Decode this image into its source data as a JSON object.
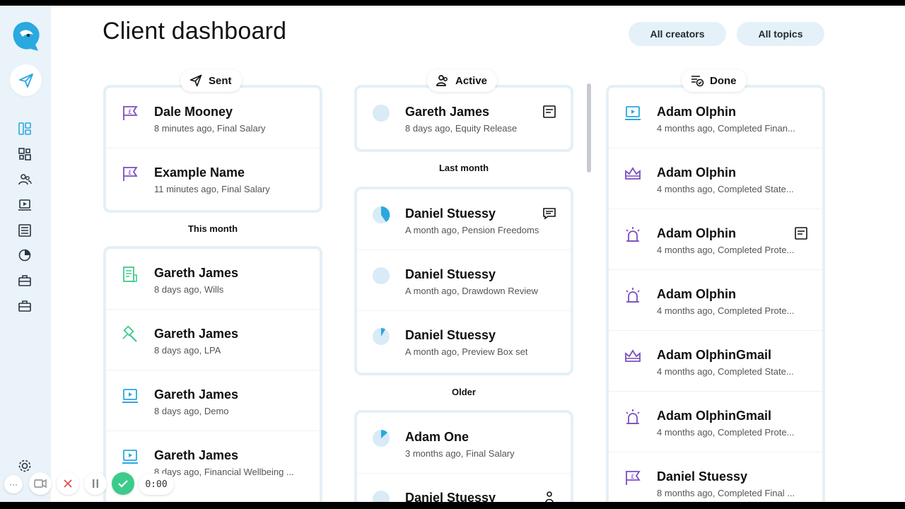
{
  "header": {
    "title": "Client dashboard",
    "filters": [
      "All creators",
      "All topics"
    ]
  },
  "columns": {
    "sent": {
      "label": "Sent",
      "groups": [
        {
          "heading": "",
          "items": [
            {
              "name": "Dale Mooney",
              "sub": "8 minutes ago, Final Salary",
              "icon": "pound-flag-icon"
            },
            {
              "name": "Example Name",
              "sub": "11 minutes ago, Final Salary",
              "icon": "pound-flag-icon"
            }
          ]
        },
        {
          "heading": "This month",
          "items": [
            {
              "name": "Gareth James",
              "sub": "8 days ago, Wills",
              "icon": "document-icon"
            },
            {
              "name": "Gareth James",
              "sub": "8 days ago, LPA",
              "icon": "gavel-icon"
            },
            {
              "name": "Gareth James",
              "sub": "8 days ago, Demo",
              "icon": "video-box-icon"
            },
            {
              "name": "Gareth James",
              "sub": "8 days ago, Financial Wellbeing ...",
              "icon": "video-box-icon"
            }
          ]
        }
      ]
    },
    "active": {
      "label": "Active",
      "groups": [
        {
          "heading": "",
          "items": [
            {
              "name": "Gareth James",
              "sub": "8 days ago, Equity Release",
              "icon": "progress-empty-icon",
              "flag": "note-icon"
            }
          ]
        },
        {
          "heading": "Last month",
          "items": [
            {
              "name": "Daniel Stuessy",
              "sub": "A month ago, Pension Freedoms",
              "icon": "progress-40-icon",
              "flag": "chat-icon"
            },
            {
              "name": "Daniel Stuessy",
              "sub": "A month ago, Drawdown Review",
              "icon": "progress-empty-icon"
            },
            {
              "name": "Daniel Stuessy",
              "sub": "A month ago, Preview Box set",
              "icon": "progress-10-icon"
            }
          ]
        },
        {
          "heading": "Older",
          "items": [
            {
              "name": "Adam One",
              "sub": "3 months ago, Final Salary",
              "icon": "progress-15-icon"
            },
            {
              "name": "Daniel Stuessy",
              "sub": "",
              "icon": "progress-empty-icon",
              "flag": "person-icon"
            }
          ]
        }
      ]
    },
    "done": {
      "label": "Done",
      "groups": [
        {
          "heading": "",
          "items": [
            {
              "name": "Adam Olphin",
              "sub": "4 months ago, Completed Finan...",
              "icon": "video-box-icon"
            },
            {
              "name": "Adam Olphin",
              "sub": "4 months ago, Completed State...",
              "icon": "crown-icon"
            },
            {
              "name": "Adam Olphin",
              "sub": "4 months ago, Completed Prote...",
              "icon": "alarm-icon",
              "flag": "note-icon"
            },
            {
              "name": "Adam Olphin",
              "sub": "4 months ago, Completed Prote...",
              "icon": "alarm-icon"
            },
            {
              "name": "Adam OlphinGmail",
              "sub": "4 months ago, Completed State...",
              "icon": "crown-icon"
            },
            {
              "name": "Adam OlphinGmail",
              "sub": "4 months ago, Completed Prote...",
              "icon": "alarm-icon"
            },
            {
              "name": "Daniel Stuessy",
              "sub": "8 months ago, Completed Final ...",
              "icon": "pound-flag-icon"
            }
          ]
        }
      ]
    }
  },
  "recorder": {
    "time": "0:00"
  },
  "colors": {
    "accent": "#2aa8e0",
    "purple": "#7b4fc0",
    "green": "#3ccb8a",
    "sidebar": "#eaf3f9"
  }
}
